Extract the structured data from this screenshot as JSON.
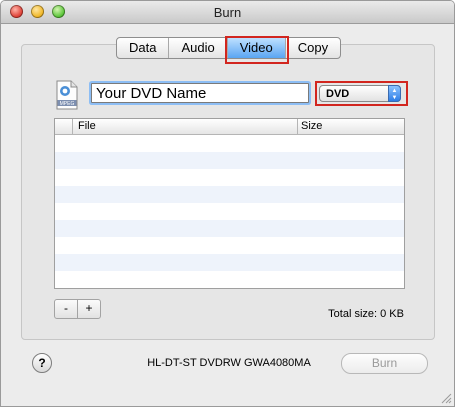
{
  "window": {
    "title": "Burn",
    "traffic_lights": [
      "close",
      "minimize",
      "zoom"
    ]
  },
  "tabs": [
    {
      "label": "Data",
      "selected": false
    },
    {
      "label": "Audio",
      "selected": false
    },
    {
      "label": "Video",
      "selected": true
    },
    {
      "label": "Copy",
      "selected": false
    }
  ],
  "icon": {
    "name": "mpeg-file-icon",
    "label": "MPEG"
  },
  "disc_name": {
    "value": "Your DVD Name"
  },
  "format_popup": {
    "selected": "DVD"
  },
  "file_table": {
    "columns": [
      "File",
      "Size"
    ],
    "rows": []
  },
  "footer": {
    "remove_label": "-",
    "add_label": "+",
    "total_size": "Total size: 0 KB"
  },
  "bottom": {
    "help_label": "?",
    "device": "HL-DT-ST DVDRW GWA4080MA",
    "burn_label": "Burn",
    "burn_enabled": false
  },
  "highlight_color": "#d2261f"
}
